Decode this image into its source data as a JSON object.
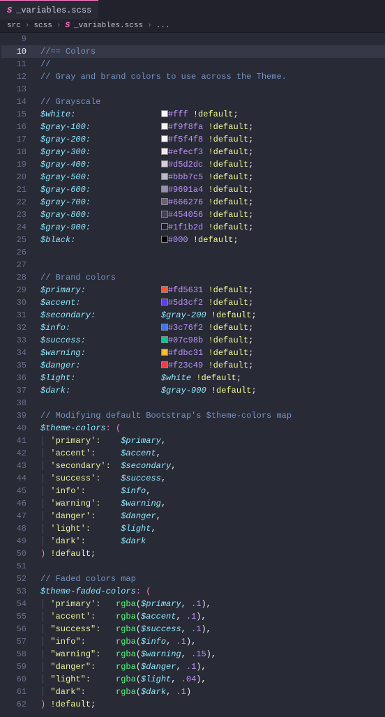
{
  "tab": {
    "label": "_variables.scss"
  },
  "breadcrumbs": {
    "a": "src",
    "b": "scss",
    "c": "_variables.scss",
    "d": "..."
  },
  "lines": {
    "first": 9,
    "last": 62,
    "active": 10
  },
  "comments": {
    "l10": "//== Colors",
    "l11": "//",
    "l12": "// Gray and brand colors to use across the Theme.",
    "l14": "// Grayscale",
    "l28": "// Brand colors",
    "l39": "// Modifying default Bootstrap's $theme-colors map",
    "l52": "// Faded colors map"
  },
  "gray": [
    {
      "name": "$white",
      "hex": "#fff",
      "sw": "#ffffff"
    },
    {
      "name": "$gray-100",
      "hex": "#f9f8fa",
      "sw": "#f9f8fa"
    },
    {
      "name": "$gray-200",
      "hex": "#f5f4f8",
      "sw": "#f5f4f8"
    },
    {
      "name": "$gray-300",
      "hex": "#efecf3",
      "sw": "#efecf3"
    },
    {
      "name": "$gray-400",
      "hex": "#d5d2dc",
      "sw": "#d5d2dc"
    },
    {
      "name": "$gray-500",
      "hex": "#bbb7c5",
      "sw": "#bbb7c5"
    },
    {
      "name": "$gray-600",
      "hex": "#9691a4",
      "sw": "#9691a4"
    },
    {
      "name": "$gray-700",
      "hex": "#666276",
      "sw": "#666276"
    },
    {
      "name": "$gray-800",
      "hex": "#454056",
      "sw": "#454056"
    },
    {
      "name": "$gray-900",
      "hex": "#1f1b2d",
      "sw": "#1f1b2d"
    },
    {
      "name": "$black",
      "hex": "#000",
      "sw": "#000000"
    }
  ],
  "brand": [
    {
      "name": "$primary",
      "hex": "#fd5631",
      "sw": "#fd5631"
    },
    {
      "name": "$accent",
      "hex": "#5d3cf2",
      "sw": "#5d3cf2"
    },
    {
      "name": "$secondary",
      "ref": "$gray-200"
    },
    {
      "name": "$info",
      "hex": "#3c76f2",
      "sw": "#3c76f2"
    },
    {
      "name": "$success",
      "hex": "#07c98b",
      "sw": "#07c98b"
    },
    {
      "name": "$warning",
      "hex": "#fdbc31",
      "sw": "#fdbc31"
    },
    {
      "name": "$danger",
      "hex": "#f23c49",
      "sw": "#f23c49"
    },
    {
      "name": "$light",
      "ref": "$white"
    },
    {
      "name": "$dark",
      "ref": "$gray-900"
    }
  ],
  "themeMap": [
    {
      "k": "'primary'",
      "v": "$primary"
    },
    {
      "k": "'accent'",
      "v": "$accent"
    },
    {
      "k": "'secondary'",
      "v": "$secondary"
    },
    {
      "k": "'success'",
      "v": "$success"
    },
    {
      "k": "'info'",
      "v": "$info"
    },
    {
      "k": "'warning'",
      "v": "$warning"
    },
    {
      "k": "'danger'",
      "v": "$danger"
    },
    {
      "k": "'light'",
      "v": "$light"
    },
    {
      "k": "'dark'",
      "v": "$dark"
    }
  ],
  "fadedMap": [
    {
      "k": "'primary'",
      "v": "$primary",
      "a": ".1"
    },
    {
      "k": "'accent'",
      "v": "$accent",
      "a": ".1"
    },
    {
      "k": "\"success\"",
      "v": "$success",
      "a": ".1"
    },
    {
      "k": "\"info\"",
      "v": "$info",
      "a": ".1"
    },
    {
      "k": "\"warning\"",
      "v": "$warning",
      "a": ".15"
    },
    {
      "k": "\"danger\"",
      "v": "$danger",
      "a": ".1"
    },
    {
      "k": "\"light\"",
      "v": "$light",
      "a": ".04"
    },
    {
      "k": "\"dark\"",
      "v": "$dark",
      "a": ".1"
    }
  ],
  "tokens": {
    "default": "!default",
    "themeVar": "$theme-colors",
    "fadedVar": "$theme-faded-colors",
    "rgba": "rgba",
    "openp": ": (",
    "closep": ") "
  }
}
